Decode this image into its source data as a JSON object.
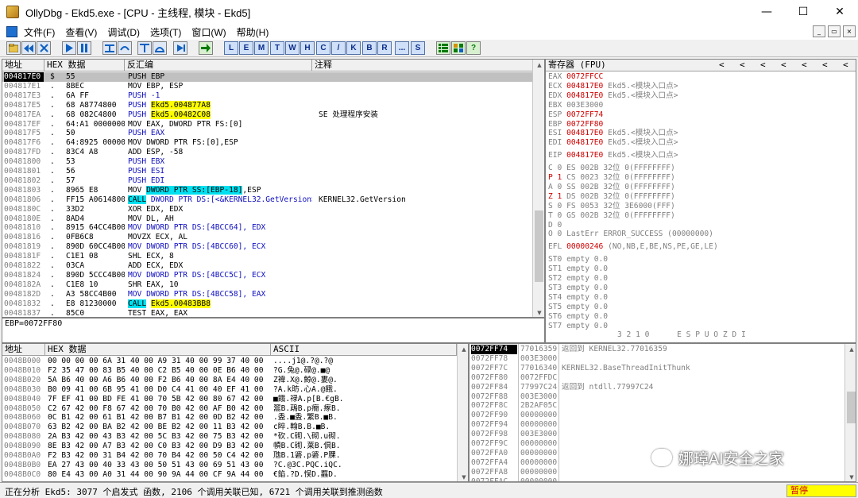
{
  "window": {
    "title": "OllyDbg - Ekd5.exe - [CPU - 主线程, 模块 - Ekd5]",
    "minimize": "—",
    "maximize": "☐",
    "close": "✕"
  },
  "menu": {
    "items": [
      "文件(F)",
      "查看(V)",
      "调试(D)",
      "选项(T)",
      "窗口(W)",
      "帮助(H)"
    ],
    "mdi": [
      "_",
      "▭",
      "×"
    ]
  },
  "toolbar": {
    "icon_buttons": [
      "open-icon",
      "rewind-icon",
      "close-process-icon",
      "run-icon",
      "pause-icon",
      "step-into-icon",
      "step-over-icon",
      "trace-into-icon",
      "trace-over-icon",
      "execute-till-return-icon",
      "goto-icon"
    ],
    "letter_buttons": [
      "L",
      "E",
      "M",
      "T",
      "W",
      "H",
      "C",
      "/",
      "K",
      "B",
      "R",
      "...",
      "S"
    ],
    "right_buttons": [
      "list-icon",
      "grid-icon",
      "help-icon"
    ],
    "help_label": "?"
  },
  "disasm": {
    "headers": {
      "addr": "地址",
      "hex": "HEX 数据",
      "asm": "反汇编",
      "comment": "注释"
    },
    "rows": [
      {
        "addr": "004817E0",
        "mark": "$",
        "hex": "55",
        "asm": "PUSH EBP",
        "comment": "",
        "kind": "selected"
      },
      {
        "addr": "004817E1",
        "mark": ".",
        "hex": "8BEC",
        "asm": "MOV EBP, ESP",
        "comment": "",
        "kind": "plain"
      },
      {
        "addr": "004817E3",
        "mark": ".",
        "hex": "6A FF",
        "asm": "PUSH -1",
        "comment": "",
        "kind": "push-imm"
      },
      {
        "addr": "004817E5",
        "mark": ".",
        "hex": "68 A8774800",
        "asm_pre": "PUSH ",
        "asm_hl": "Ekd5.004877A8",
        "comment": "",
        "kind": "push-yellow"
      },
      {
        "addr": "004817EA",
        "mark": ".",
        "hex": "68 082C4800",
        "asm_pre": "PUSH ",
        "asm_hl": "Ekd5.00482C08",
        "comment": "SE 处理程序安装",
        "kind": "push-yellow"
      },
      {
        "addr": "004817EF",
        "mark": ".",
        "hex": "64:A1 00000000",
        "asm": "MOV EAX, DWORD PTR FS:[0]",
        "comment": "",
        "kind": "plain"
      },
      {
        "addr": "004817F5",
        "mark": ".",
        "hex": "50",
        "asm": "PUSH EAX",
        "comment": "",
        "kind": "push"
      },
      {
        "addr": "004817F6",
        "mark": ".",
        "hex": "64:8925 0000000",
        "asm": "MOV DWORD PTR FS:[0],ESP",
        "comment": "",
        "kind": "plain"
      },
      {
        "addr": "004817FD",
        "mark": ".",
        "hex": "83C4 A8",
        "asm": "ADD ESP, -58",
        "comment": "",
        "kind": "add-imm"
      },
      {
        "addr": "00481800",
        "mark": ".",
        "hex": "53",
        "asm": "PUSH EBX",
        "comment": "",
        "kind": "push"
      },
      {
        "addr": "00481801",
        "mark": ".",
        "hex": "56",
        "asm": "PUSH ESI",
        "comment": "",
        "kind": "push"
      },
      {
        "addr": "00481802",
        "mark": ".",
        "hex": "57",
        "asm": "PUSH EDI",
        "comment": "",
        "kind": "push"
      },
      {
        "addr": "00481803",
        "mark": ".",
        "hex": "8965 E8",
        "asm_pre": "MOV ",
        "asm_hl": "DWORD PTR SS:[EBP-18]",
        "asm_post": ",ESP",
        "comment": "",
        "kind": "mov-cyan"
      },
      {
        "addr": "00481806",
        "mark": ".",
        "hex": "FF15 A0614800",
        "asm_hl": "CALL",
        "asm_post": " DWORD PTR DS:[<&KERNEL32.GetVersion>]",
        "comment": "KERNEL32.GetVersion",
        "kind": "call-ind"
      },
      {
        "addr": "0048180C",
        "mark": ".",
        "hex": "33D2",
        "asm": "XOR EDX, EDX",
        "comment": "",
        "kind": "plain"
      },
      {
        "addr": "0048180E",
        "mark": ".",
        "hex": "8AD4",
        "asm": "MOV DL, AH",
        "comment": "",
        "kind": "plain"
      },
      {
        "addr": "00481810",
        "mark": ".",
        "hex": "8915 64CC4B00",
        "asm": "MOV DWORD PTR DS:[4BCC64], EDX",
        "comment": "",
        "kind": "mov-mem"
      },
      {
        "addr": "00481816",
        "mark": ".",
        "hex": "0FB6C8",
        "asm": "MOVZX ECX, AL",
        "comment": "",
        "kind": "plain"
      },
      {
        "addr": "00481819",
        "mark": ".",
        "hex": "890D 60CC4B00",
        "asm": "MOV DWORD PTR DS:[4BCC60], ECX",
        "comment": "",
        "kind": "mov-mem"
      },
      {
        "addr": "0048181F",
        "mark": ".",
        "hex": "C1E1 08",
        "asm": "SHL ECX, 8",
        "comment": "",
        "kind": "shift-imm"
      },
      {
        "addr": "00481822",
        "mark": ".",
        "hex": "03CA",
        "asm": "ADD ECX, EDX",
        "comment": "",
        "kind": "plain"
      },
      {
        "addr": "00481824",
        "mark": ".",
        "hex": "890D 5CCC4B00",
        "asm": "MOV DWORD PTR DS:[4BCC5C], ECX",
        "comment": "",
        "kind": "mov-mem"
      },
      {
        "addr": "0048182A",
        "mark": ".",
        "hex": "C1E8 10",
        "asm": "SHR EAX, 10",
        "comment": "",
        "kind": "shift-imm"
      },
      {
        "addr": "0048182D",
        "mark": ".",
        "hex": "A3 58CC4B00",
        "asm": "MOV DWORD PTR DS:[4BCC58], EAX",
        "comment": "",
        "kind": "mov-mem"
      },
      {
        "addr": "00481832",
        "mark": ".",
        "hex": "E8 81230000",
        "asm_hl": "CALL",
        "asm_post": " ",
        "asm_hl2": "Ekd5.00483BB8",
        "comment": "",
        "kind": "call-direct"
      },
      {
        "addr": "00481837",
        "mark": ".",
        "hex": "85C0",
        "asm": "TEST EAX, EAX",
        "comment": "",
        "kind": "plain"
      }
    ],
    "info": "EBP=0072FF80"
  },
  "registers": {
    "header": "寄存器 (FPU)",
    "arrows": [
      "<",
      "<",
      "<",
      "<",
      "<",
      "<",
      "<"
    ],
    "gpr": [
      {
        "name": "EAX",
        "value": "0072FFCC",
        "note": "",
        "color": "red"
      },
      {
        "name": "ECX",
        "value": "004817E0",
        "note": "Ekd5.<模块入口点>",
        "color": "red"
      },
      {
        "name": "EDX",
        "value": "004817E0",
        "note": "Ekd5.<模块入口点>",
        "color": "red"
      },
      {
        "name": "EBX",
        "value": "003E3000",
        "note": "",
        "color": "gray"
      },
      {
        "name": "ESP",
        "value": "0072FF74",
        "note": "",
        "color": "red"
      },
      {
        "name": "EBP",
        "value": "0072FF80",
        "note": "",
        "color": "red"
      },
      {
        "name": "ESI",
        "value": "004817E0",
        "note": "Ekd5.<模块入口点>",
        "color": "red"
      },
      {
        "name": "EDI",
        "value": "004817E0",
        "note": "Ekd5.<模块入口点>",
        "color": "red"
      }
    ],
    "eip": {
      "name": "EIP",
      "value": "004817E0",
      "note": "Ekd5.<模块入口点>"
    },
    "flags": [
      {
        "f": "C 0",
        "text": "ES 002B 32位 0(FFFFFFFF)",
        "red": false
      },
      {
        "f": "P 1",
        "text": "CS 0023 32位 0(FFFFFFFF)",
        "red": true
      },
      {
        "f": "A 0",
        "text": "SS 002B 32位 0(FFFFFFFF)",
        "red": false
      },
      {
        "f": "Z 1",
        "text": "DS 002B 32位 0(FFFFFFFF)",
        "red": true
      },
      {
        "f": "S 0",
        "text": "FS 0053 32位 3E6000(FFF)",
        "red": false
      },
      {
        "f": "T 0",
        "text": "GS 002B 32位 0(FFFFFFFF)",
        "red": false
      },
      {
        "f": "D 0",
        "text": "",
        "red": false
      },
      {
        "f": "O 0",
        "text": "LastErr ERROR_SUCCESS (00000000)",
        "red": false
      }
    ],
    "efl": {
      "name": "EFL",
      "value": "00000246",
      "note": "(NO,NB,E,BE,NS,PE,GE,LE)"
    },
    "fpu": [
      "ST0 empty 0.0",
      "ST1 empty 0.0",
      "ST2 empty 0.0",
      "ST3 empty 0.0",
      "ST4 empty 0.0",
      "ST5 empty 0.0",
      "ST6 empty 0.0",
      "ST7 empty 0.0"
    ],
    "fpu_footer": "3 2 1 0      E S P U O Z D I"
  },
  "dump": {
    "headers": {
      "addr": "地址",
      "hex": "HEX 数据",
      "ascii": "ASCII"
    },
    "rows": [
      {
        "addr": "0048B000",
        "hex": "00 00 00 00 6A 31 40 00 A9 31 40 00 99 37 40 00",
        "ascii": "....j1@.?@.?@"
      },
      {
        "addr": "0048B010",
        "hex": "F2 35 47 00 83 B5 40 00 C2 B5 40 00 0E B6 40 00",
        "ascii": "?G.兔@.碌@.■@"
      },
      {
        "addr": "0048B020",
        "hex": "5A B6 40 00 A6 B6 40 00 F2 B6 40 00 8A E4 40 00",
        "ascii": "Z禕.X@.鯨@.婁@."
      },
      {
        "addr": "0048B030",
        "hex": "B0 09 41 00 6B 95 41 00 D0 C4 41 00 40 EF 41 00",
        "ascii": "?A.k昉.心A.@餓."
      },
      {
        "addr": "0048B040",
        "hex": "7F EF 41 00 BD FE 41 00 70 5B 42 00 80 67 42 00",
        "ascii": "■餓.禄A.p[B.€gB."
      },
      {
        "addr": "0048B050",
        "hex": "C2 67 42 00 F8 67 42 00 70 B0 42 00 AF B0 42 00",
        "ascii": "翯B.鴊B.p癇.瘃B."
      },
      {
        "addr": "0048B060",
        "ascii": ".盉.■盉.繁B.■B.",
        "hex": "0C B1 42 00 61 B1 42 00 B7 B1 42 00 0D B2 42 00"
      },
      {
        "addr": "0048B070",
        "hex": "63 B2 42 00 BA B2 42 00 BE B2 42 00 11 B3 42 00",
        "ascii": "c睟.翰B.B.■B."
      },
      {
        "addr": "0048B080",
        "hex": "2A B3 42 00 43 B3 42 00 5C B3 42 00 75 B3 42 00",
        "ascii": "*砍.C砌.\\砌.u砌."
      },
      {
        "addr": "0048B090",
        "hex": "8E B3 42 00 A7 B3 42 00 C0 B3 42 00 D9 B3 42 00",
        "ascii": "幊B.C砌.莱B.倶B."
      },
      {
        "addr": "0048B0A0",
        "hex": "F2 B3 42 00 31 B4 42 00 70 B4 42 00 50 C4 42 00",
        "ascii": "虺B.1碆.p碆.P腂."
      },
      {
        "addr": "0048B0B0",
        "hex": "EA 27 43 00 40 33 43 00 50 51 43 00 69 51 43 00",
        "ascii": "?C.@3C.PQC.iQC."
      },
      {
        "addr": "0048B0C0",
        "hex": "80 E4 43 00 A0 31 44 00 90 9A 44 00 CF 9A 44 00",
        "ascii": "€錎.?D.悮D.蠚D."
      }
    ]
  },
  "stack": {
    "rows": [
      {
        "addr": "0072FF74",
        "value": "77016359",
        "comment": "返回到 KERNEL32.77016359",
        "selected": true
      },
      {
        "addr": "0072FF78",
        "value": "003E3000",
        "comment": ""
      },
      {
        "addr": "0072FF7C",
        "value": "77016340",
        "comment": "KERNEL32.BaseThreadInitThunk"
      },
      {
        "addr": "0072FF80",
        "value": "0072FFDC",
        "comment": ""
      },
      {
        "addr": "0072FF84",
        "value": "77997C24",
        "comment": "返回到 ntdll.77997C24"
      },
      {
        "addr": "0072FF88",
        "value": "003E3000",
        "comment": ""
      },
      {
        "addr": "0072FF8C",
        "value": "2B2AF05C",
        "comment": ""
      },
      {
        "addr": "0072FF90",
        "value": "00000000",
        "comment": ""
      },
      {
        "addr": "0072FF94",
        "value": "00000000",
        "comment": ""
      },
      {
        "addr": "0072FF98",
        "value": "003E3000",
        "comment": ""
      },
      {
        "addr": "0072FF9C",
        "value": "00000000",
        "comment": ""
      },
      {
        "addr": "0072FFA0",
        "value": "00000000",
        "comment": ""
      },
      {
        "addr": "0072FFA4",
        "value": "00000000",
        "comment": ""
      },
      {
        "addr": "0072FFA8",
        "value": "00000000",
        "comment": ""
      },
      {
        "addr": "0072FFAC",
        "value": "00000000",
        "comment": ""
      }
    ]
  },
  "status": {
    "text": "正在分析 Ekd5: 3077 个启发式 函数, 2106 个调用关联已知, 6721 个调用关联到推测函数",
    "state": "暂停"
  },
  "watermark": "娜璋AI安全之家"
}
